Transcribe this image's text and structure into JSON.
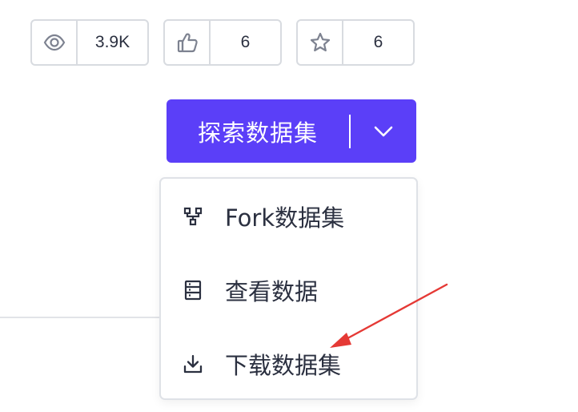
{
  "stats": {
    "views": {
      "icon": "eye-icon",
      "value": "3.9K"
    },
    "likes": {
      "icon": "thumbs-up-icon",
      "value": "6"
    },
    "stars": {
      "icon": "star-icon",
      "value": "6"
    }
  },
  "explore_button": {
    "label": "探索数据集",
    "dropdown_icon": "chevron-down-icon"
  },
  "menu": {
    "items": [
      {
        "label": "Fork数据集",
        "icon": "fork-icon"
      },
      {
        "label": "查看数据",
        "icon": "table-rows-icon"
      },
      {
        "label": "下载数据集",
        "icon": "download-icon"
      }
    ]
  },
  "annotation": {
    "type": "arrow",
    "color": "#e53935",
    "points_to": "menu.items.2"
  },
  "colors": {
    "accent": "#5b3ff8",
    "border": "#d8dbe0",
    "text": "#2b3040"
  }
}
